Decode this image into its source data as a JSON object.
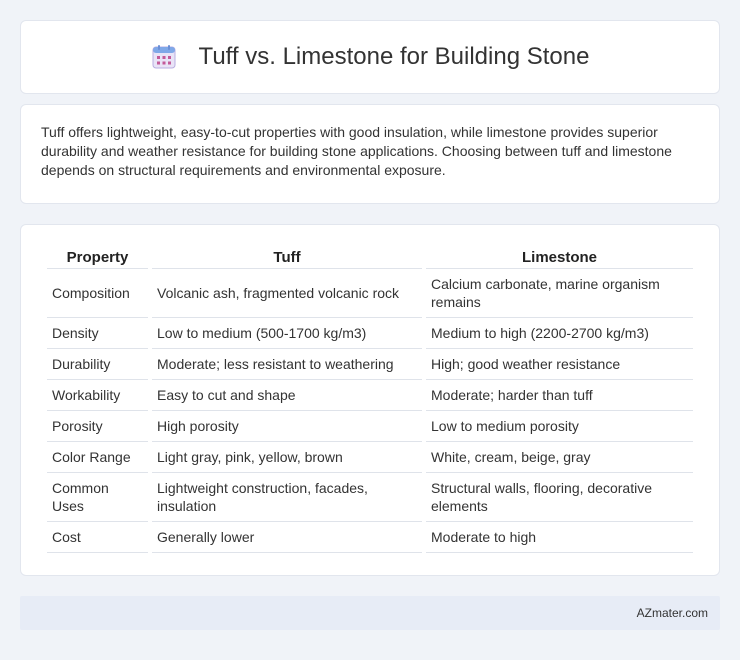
{
  "header": {
    "icon": "calendar-icon",
    "title": "Tuff vs. Limestone for Building Stone"
  },
  "intro": {
    "text": "Tuff offers lightweight, easy-to-cut properties with good insulation, while limestone provides superior durability and weather resistance for building stone applications. Choosing between tuff and limestone depends on structural requirements and environmental exposure."
  },
  "table": {
    "headers": [
      "Property",
      "Tuff",
      "Limestone"
    ],
    "rows": [
      [
        "Composition",
        "Volcanic ash, fragmented volcanic rock",
        "Calcium carbonate, marine organism remains"
      ],
      [
        "Density",
        "Low to medium (500-1700 kg/m3)",
        "Medium to high (2200-2700 kg/m3)"
      ],
      [
        "Durability",
        "Moderate; less resistant to weathering",
        "High; good weather resistance"
      ],
      [
        "Workability",
        "Easy to cut and shape",
        "Moderate; harder than tuff"
      ],
      [
        "Porosity",
        "High porosity",
        "Low to medium porosity"
      ],
      [
        "Color Range",
        "Light gray, pink, yellow, brown",
        "White, cream, beige, gray"
      ],
      [
        "Common Uses",
        "Lightweight construction, facades, insulation",
        "Structural walls, flooring, decorative elements"
      ],
      [
        "Cost",
        "Generally lower",
        "Moderate to high"
      ]
    ]
  },
  "footer": {
    "brand": "AZmater.com"
  }
}
